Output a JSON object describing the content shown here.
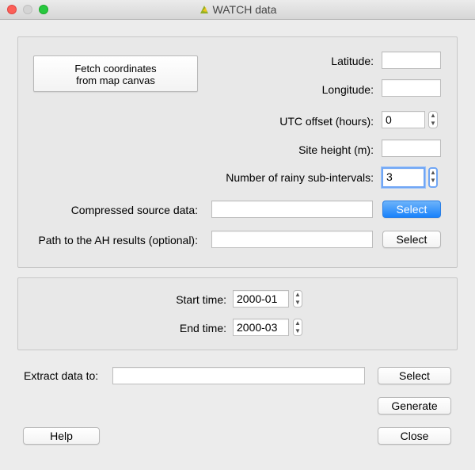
{
  "window": {
    "title": "WATCH data"
  },
  "coords": {
    "fetch_button": "Fetch coordinates\nfrom map canvas",
    "latitude_label": "Latitude:",
    "latitude_value": "",
    "longitude_label": "Longitude:",
    "longitude_value": "",
    "utc_label": "UTC offset (hours):",
    "utc_value": "0",
    "site_height_label": "Site height (m):",
    "site_height_value": "",
    "rainy_label": "Number of rainy sub-intervals:",
    "rainy_value": "3",
    "compressed_label": "Compressed source data:",
    "compressed_value": "",
    "compressed_select": "Select",
    "ah_label": "Path to the AH results (optional):",
    "ah_value": "",
    "ah_select": "Select"
  },
  "time": {
    "start_label": "Start time:",
    "start_value": "2000-01",
    "end_label": "End time:",
    "end_value": "2000-03"
  },
  "output": {
    "extract_label": "Extract data to:",
    "extract_value": "",
    "extract_select": "Select",
    "generate": "Generate",
    "help": "Help",
    "close": "Close"
  },
  "icons": {
    "spin_up": "up-arrow-icon",
    "spin_down": "down-arrow-icon",
    "app_logo": "qgis-logo-icon"
  },
  "colors": {
    "primary_button": "#1a82fb",
    "focus_ring": "#70a6f5",
    "close_dot": "#fc5f57",
    "max_dot": "#27c83f"
  }
}
